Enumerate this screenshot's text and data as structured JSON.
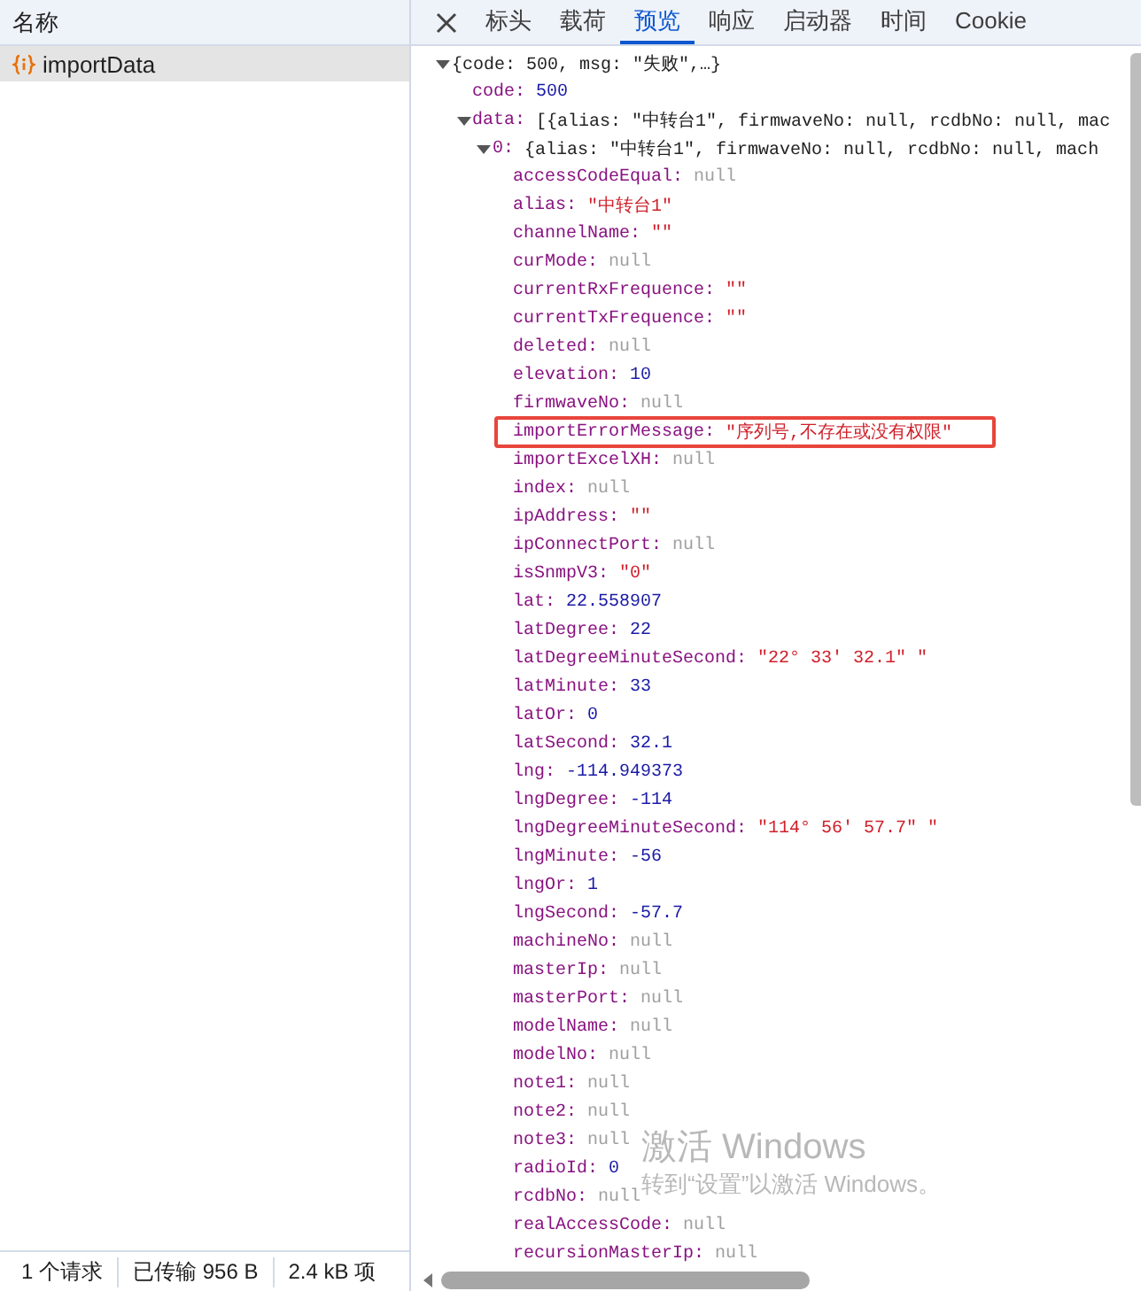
{
  "sidebar": {
    "header": "名称",
    "requests": [
      {
        "name": "importData",
        "selected": true
      }
    ]
  },
  "tabs": [
    {
      "label": "标头",
      "selected": false
    },
    {
      "label": "载荷",
      "selected": false
    },
    {
      "label": "预览",
      "selected": true
    },
    {
      "label": "响应",
      "selected": false
    },
    {
      "label": "启动器",
      "selected": false
    },
    {
      "label": "时间",
      "selected": false
    },
    {
      "label": "Cookie",
      "selected": false
    }
  ],
  "preview": {
    "tree": {
      "summary": "{code: 500, msg: \"失败\",…}",
      "expanded": true,
      "children": [
        {
          "key": "code:",
          "value": "500",
          "kind": "number"
        },
        {
          "key": "data:",
          "summary": "[{alias: \"中转台1\", firmwaveNo: null, rcdbNo: null, mac",
          "expanded": true,
          "children": [
            {
              "key": "0:",
              "summary": "{alias: \"中转台1\", firmwaveNo: null, rcdbNo: null, mach",
              "expanded": true,
              "children": [
                {
                  "key": "accessCodeEqual:",
                  "value": "null",
                  "kind": "null"
                },
                {
                  "key": "alias:",
                  "value": "\"中转台1\"",
                  "kind": "string"
                },
                {
                  "key": "channelName:",
                  "value": "\"\"",
                  "kind": "string"
                },
                {
                  "key": "curMode:",
                  "value": "null",
                  "kind": "null"
                },
                {
                  "key": "currentRxFrequence:",
                  "value": "\"\"",
                  "kind": "string"
                },
                {
                  "key": "currentTxFrequence:",
                  "value": "\"\"",
                  "kind": "string"
                },
                {
                  "key": "deleted:",
                  "value": "null",
                  "kind": "null"
                },
                {
                  "key": "elevation:",
                  "value": "10",
                  "kind": "number"
                },
                {
                  "key": "firmwaveNo:",
                  "value": "null",
                  "kind": "null"
                },
                {
                  "key": "importErrorMessage:",
                  "value": "\"序列号,不存在或没有权限\"",
                  "kind": "string",
                  "highlighted": true
                },
                {
                  "key": "importExcelXH:",
                  "value": "null",
                  "kind": "null"
                },
                {
                  "key": "index:",
                  "value": "null",
                  "kind": "null"
                },
                {
                  "key": "ipAddress:",
                  "value": "\"\"",
                  "kind": "string"
                },
                {
                  "key": "ipConnectPort:",
                  "value": "null",
                  "kind": "null"
                },
                {
                  "key": "isSnmpV3:",
                  "value": "\"0\"",
                  "kind": "string"
                },
                {
                  "key": "lat:",
                  "value": "22.558907",
                  "kind": "number"
                },
                {
                  "key": "latDegree:",
                  "value": "22",
                  "kind": "number"
                },
                {
                  "key": "latDegreeMinuteSecond:",
                  "value": "\"22° 33′ 32.1″ \"",
                  "kind": "string"
                },
                {
                  "key": "latMinute:",
                  "value": "33",
                  "kind": "number"
                },
                {
                  "key": "latOr:",
                  "value": "0",
                  "kind": "number"
                },
                {
                  "key": "latSecond:",
                  "value": "32.1",
                  "kind": "number"
                },
                {
                  "key": "lng:",
                  "value": "-114.949373",
                  "kind": "number"
                },
                {
                  "key": "lngDegree:",
                  "value": "-114",
                  "kind": "number"
                },
                {
                  "key": "lngDegreeMinuteSecond:",
                  "value": "\"114° 56′ 57.7″ \"",
                  "kind": "string"
                },
                {
                  "key": "lngMinute:",
                  "value": "-56",
                  "kind": "number"
                },
                {
                  "key": "lngOr:",
                  "value": "1",
                  "kind": "number"
                },
                {
                  "key": "lngSecond:",
                  "value": "-57.7",
                  "kind": "number"
                },
                {
                  "key": "machineNo:",
                  "value": "null",
                  "kind": "null"
                },
                {
                  "key": "masterIp:",
                  "value": "null",
                  "kind": "null"
                },
                {
                  "key": "masterPort:",
                  "value": "null",
                  "kind": "null"
                },
                {
                  "key": "modelName:",
                  "value": "null",
                  "kind": "null"
                },
                {
                  "key": "modelNo:",
                  "value": "null",
                  "kind": "null"
                },
                {
                  "key": "note1:",
                  "value": "null",
                  "kind": "null"
                },
                {
                  "key": "note2:",
                  "value": "null",
                  "kind": "null"
                },
                {
                  "key": "note3:",
                  "value": "null",
                  "kind": "null"
                },
                {
                  "key": "radioId:",
                  "value": "0",
                  "kind": "number"
                },
                {
                  "key": "rcdbNo:",
                  "value": "null",
                  "kind": "null"
                },
                {
                  "key": "realAccessCode:",
                  "value": "null",
                  "kind": "null"
                },
                {
                  "key": "recursionMasterIp:",
                  "value": "null",
                  "kind": "null"
                }
              ]
            }
          ]
        }
      ]
    }
  },
  "status_bar": [
    "1 个请求",
    "已传输 956 B",
    "2.4 kB 项"
  ],
  "os_overlay": {
    "title": "激活 Windows",
    "text": "转到“设置”以激活 Windows。"
  }
}
